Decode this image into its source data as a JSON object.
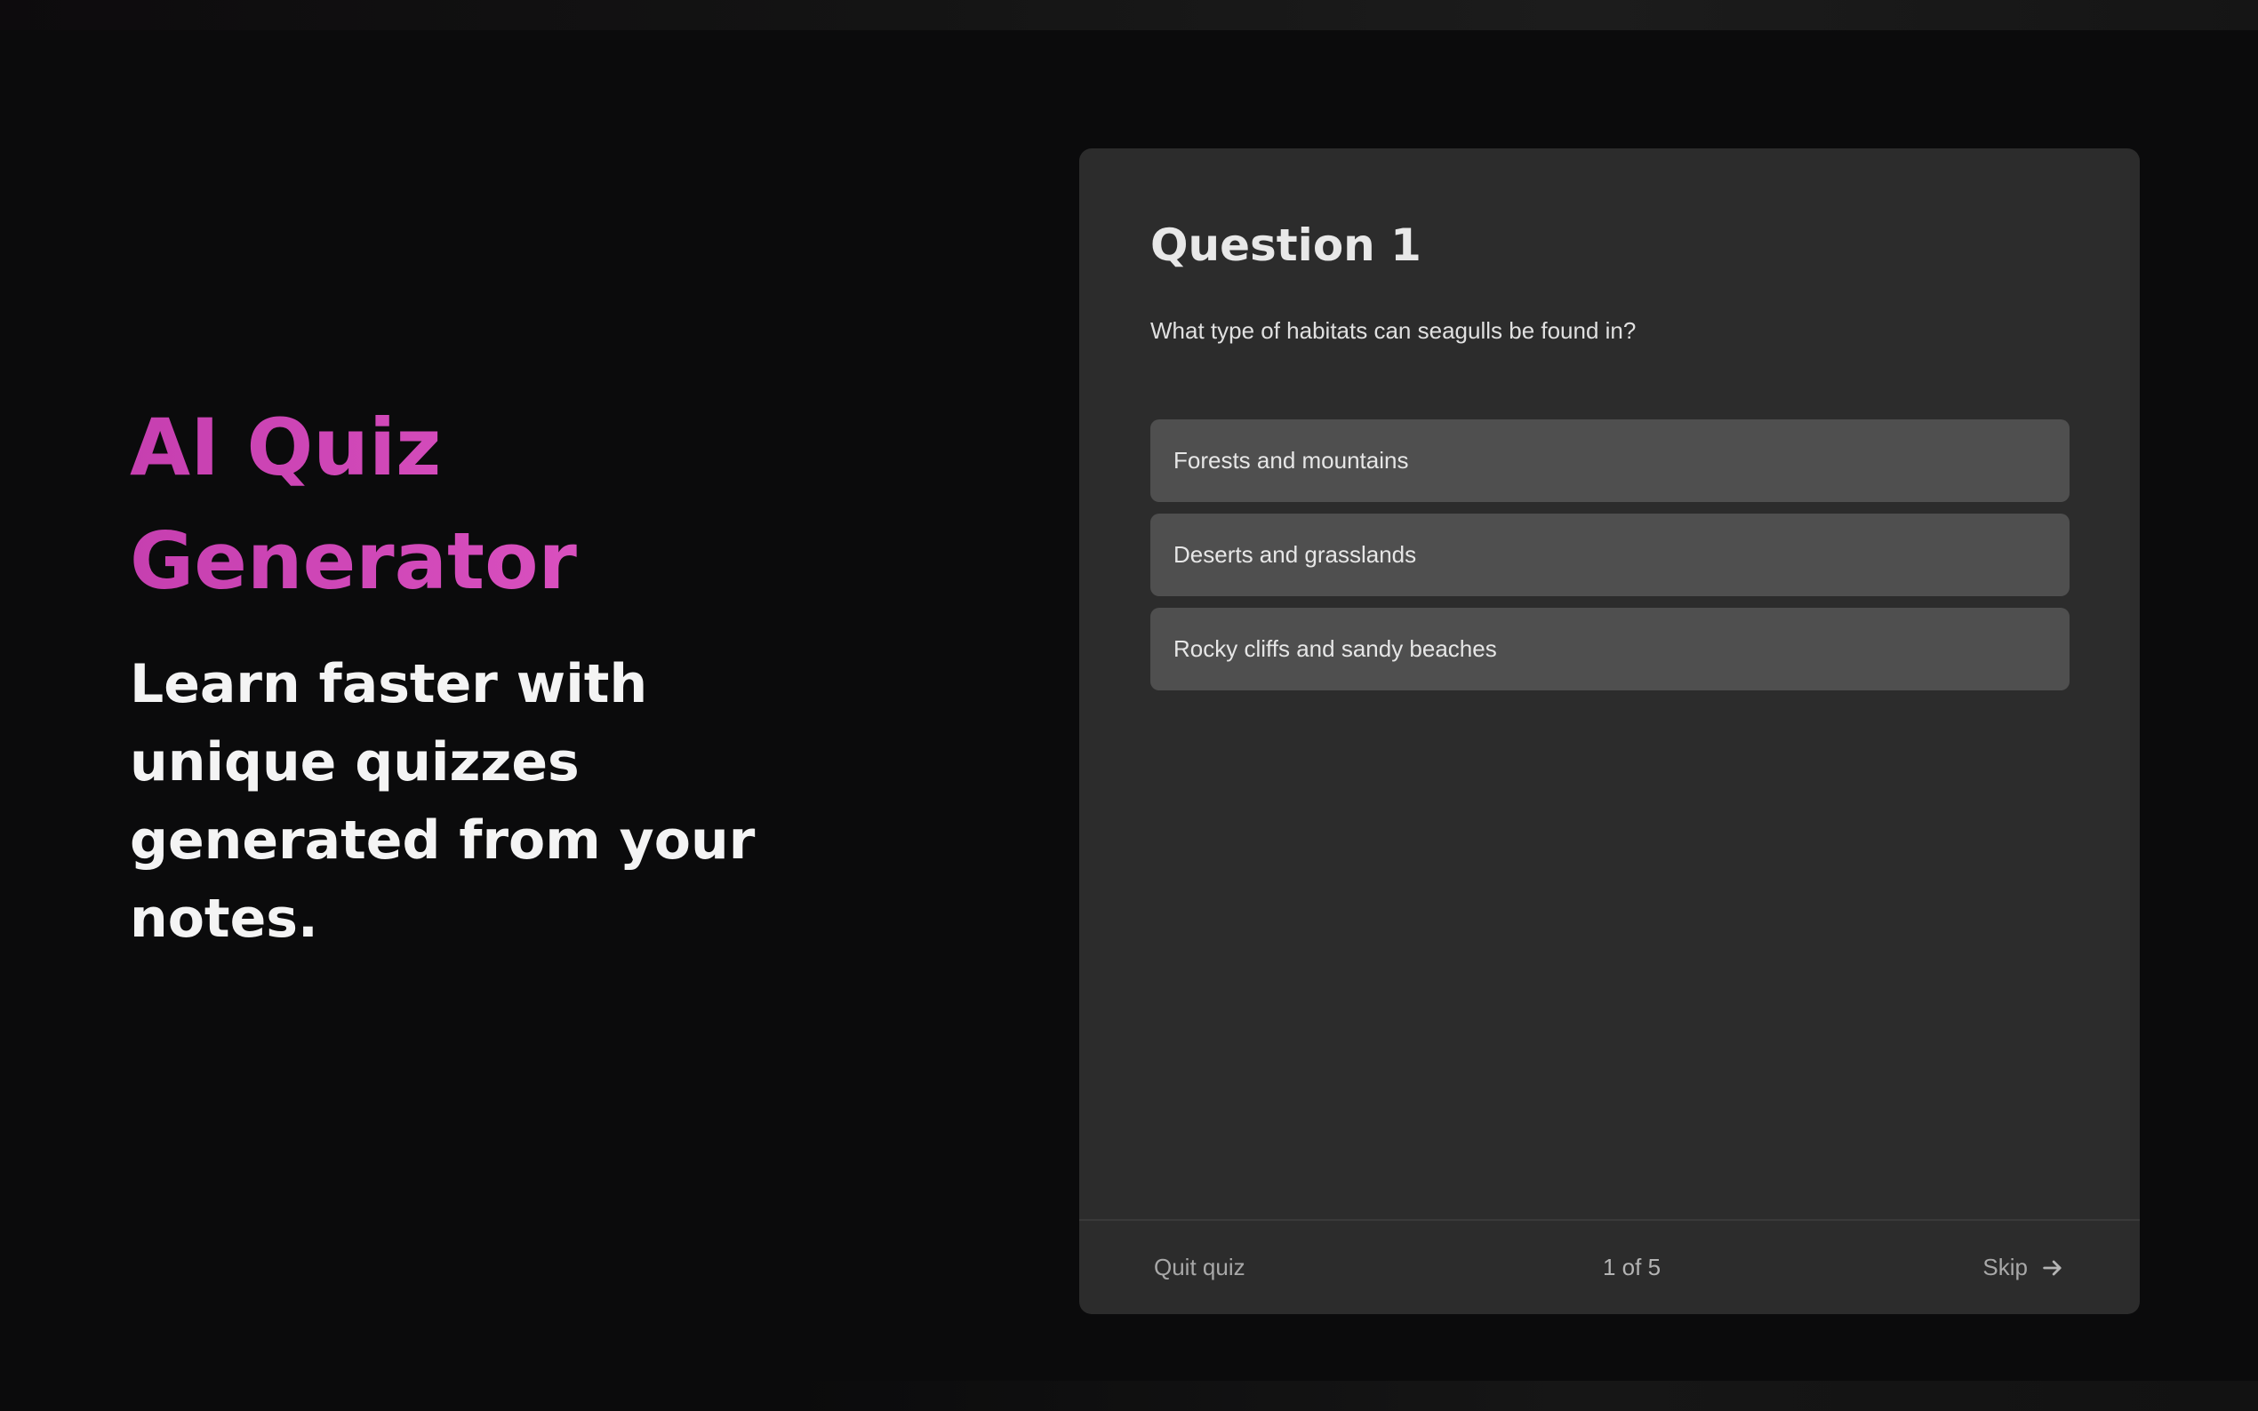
{
  "hero": {
    "title": "AI Quiz Generator",
    "subtitle": "Learn faster with unique quizzes generated from your notes.",
    "title_gradient": [
      "#c63fb0",
      "#e056c4"
    ]
  },
  "quiz": {
    "question_title": "Question 1",
    "question_text": "What type of habitats can seagulls be found in?",
    "options": [
      {
        "label": "Forests and mountains"
      },
      {
        "label": "Deserts and grasslands"
      },
      {
        "label": "Rocky cliffs and sandy beaches"
      }
    ],
    "footer": {
      "quit_label": "Quit quiz",
      "progress_label": "1 of 5",
      "skip_label": "Skip",
      "skip_icon": "arrow-right-icon"
    }
  },
  "colors": {
    "background": "#0b0b0c",
    "card": "#2c2c2c",
    "option": "#4f4f4f",
    "accent": "#d84bbd"
  }
}
